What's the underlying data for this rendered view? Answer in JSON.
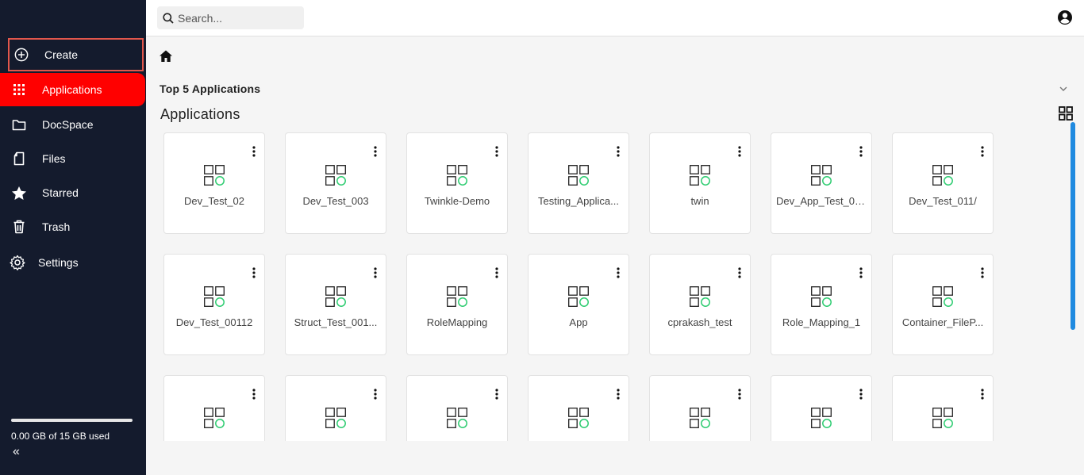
{
  "sidebar": {
    "create_label": "Create",
    "items": [
      {
        "label": "Applications",
        "icon": "grid-icon"
      },
      {
        "label": "DocSpace",
        "icon": "folder-icon"
      },
      {
        "label": "Files",
        "icon": "file-icon"
      },
      {
        "label": "Starred",
        "icon": "star-icon"
      },
      {
        "label": "Trash",
        "icon": "trash-icon"
      },
      {
        "label": "Settings",
        "icon": "gear-icon"
      }
    ],
    "storage_text": "0.00 GB of 15 GB used",
    "storage_used_fraction": 0.0,
    "collapse_label": "«"
  },
  "topbar": {
    "search_placeholder": "Search..."
  },
  "main": {
    "top5_label": "Top 5 Applications",
    "section_title": "Applications",
    "apps": [
      "Dev_Test_02",
      "Dev_Test_003",
      "Twinkle-Demo",
      "Testing_Applica...",
      "twin",
      "Dev_App_Test_00...",
      "Dev_Test_011/",
      "Dev_Test_00112",
      "Struct_Test_001...",
      "RoleMapping",
      "App",
      "cprakash_test",
      "Role_Mapping_1",
      "Container_FileP...",
      "",
      "",
      "",
      "",
      "",
      "",
      ""
    ]
  },
  "colors": {
    "sidebar_bg": "#141b2d",
    "active_bg": "#ff0000",
    "create_border": "#e2574c",
    "app_icon_accent": "#2ecc71",
    "scrollbar": "#1f8ae0"
  }
}
